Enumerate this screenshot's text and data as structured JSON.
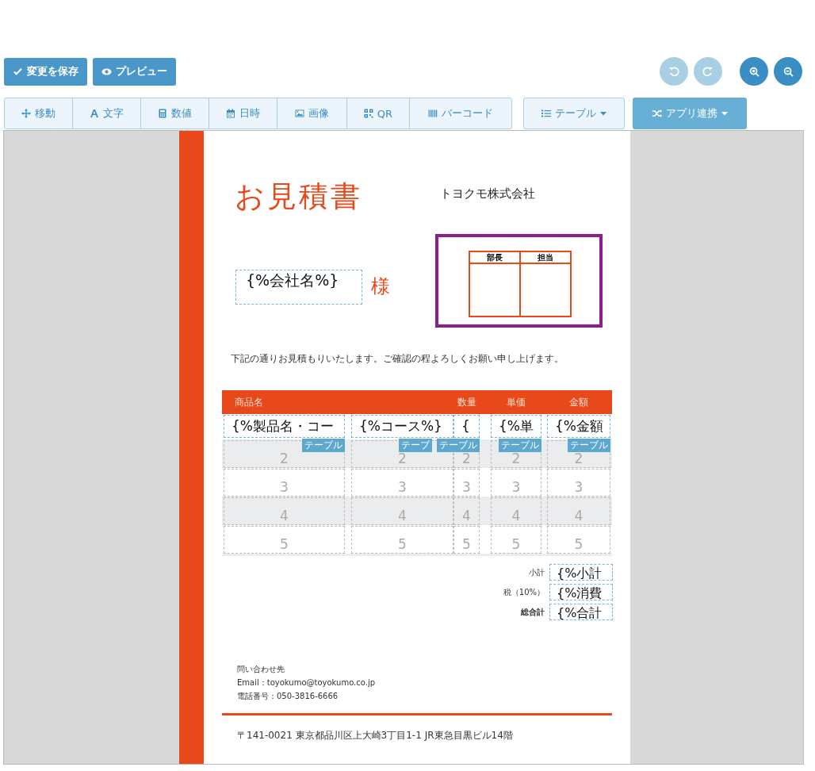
{
  "toolbar": {
    "save": "変更を保存",
    "preview": "プレビュー",
    "undo": {
      "disabled": true
    },
    "redo": {
      "disabled": true
    }
  },
  "tools": [
    {
      "kind": "move",
      "label": "移動"
    },
    {
      "kind": "text",
      "label": "文字"
    },
    {
      "kind": "number",
      "label": "数値"
    },
    {
      "kind": "date",
      "label": "日時"
    },
    {
      "kind": "image",
      "label": "画像"
    },
    {
      "kind": "qr",
      "label": "QR"
    },
    {
      "kind": "barcode",
      "label": "バーコード"
    }
  ],
  "table_menu": "テーブル",
  "app_menu": "アプリ連携",
  "document": {
    "title": "お見積書",
    "company": "トヨクモ株式会社",
    "recipient": "{%会社名%}",
    "honorific": "様",
    "stamp_headers": [
      "部長",
      "担当"
    ],
    "intro": "下記の通りお見積もりいたします。ご確認の程よろしくお願い申し上げます。",
    "columns": [
      {
        "label": "商品名"
      },
      {},
      {
        "label": "数量"
      },
      {
        "label": "単価"
      },
      {
        "label": "金額"
      }
    ],
    "first_row": [
      {
        "text": "{%製品名・コー",
        "tag": "テーブル"
      },
      {
        "text": "{%コース%}",
        "tag": "テーブ"
      },
      {
        "text": "{",
        "tag": "テーブル"
      },
      {
        "text": "{%単",
        "tag": "テーブル"
      },
      {
        "text": "{%金額",
        "tag": "テーブル"
      }
    ],
    "rows": [
      [
        "2",
        "2",
        "2",
        "2",
        "2"
      ],
      [
        "3",
        "3",
        "3",
        "3",
        "3"
      ],
      [
        "4",
        "4",
        "4",
        "4",
        "4"
      ],
      [
        "5",
        "5",
        "5",
        "5",
        "5"
      ]
    ],
    "totals": [
      {
        "label": "小計",
        "value": "{%小計",
        "bold": false
      },
      {
        "label": "税（10%）",
        "value": "{%消費",
        "bold": false
      },
      {
        "label": "総合計",
        "value": "{%合計",
        "bold": true
      }
    ],
    "contact": [
      "問い合わせ先",
      "Email：toyokumo@toyokumo.co.jp",
      "電話番号：050-3816-6666"
    ],
    "address": "〒141-0021 東京都品川区上大崎3丁目1-1 JR東急目黒ビル14階"
  }
}
